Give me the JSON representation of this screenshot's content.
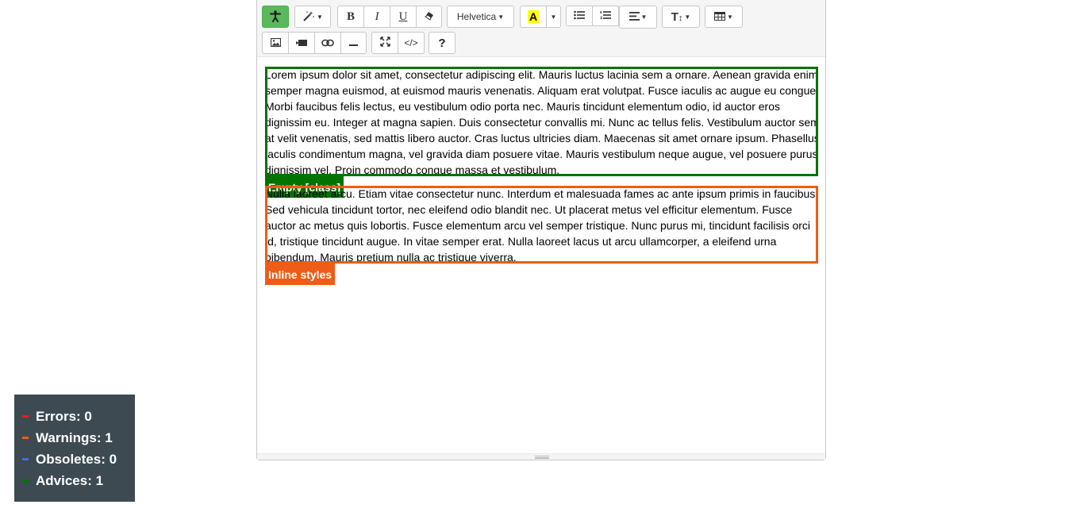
{
  "toolbar": {
    "font_name": "Helvetica",
    "code_view_label": "</>",
    "help_label": "?",
    "bold_label": "B",
    "italic_label": "I",
    "underline_label": "U",
    "text_size_label": "T"
  },
  "content": {
    "paragraph_1": "Lorem ipsum dolor sit amet, consectetur adipiscing elit. Mauris luctus lacinia sem a ornare. Aenean gravida enim semper magna euismod, at euismod mauris venenatis. Aliquam erat volutpat. Fusce iaculis ac augue eu congue. Morbi faucibus felis lectus, eu vestibulum odio porta nec. Mauris tincidunt elementum odio, id auctor eros dignissim eu. Integer at magna sapien. Duis consectetur convallis mi. Nunc ac tellus felis. Vestibulum auctor sem at velit venenatis, sed mattis libero auctor. Cras luctus ultricies diam. Maecenas sit amet ornare ipsum. Phasellus iaculis condimentum magna, vel gravida diam posuere vitae. Mauris vestibulum neque augue, vel posuere purus dignissim vel. Proin commodo congue massa et vestibulum.",
    "paragraph_2": "Nulla laoreet arcu. Etiam vitae consectetur nunc. Interdum et malesuada fames ac ante ipsum primis in faucibus. Sed vehicula tincidunt tortor, nec eleifend odio blandit nec. Ut placerat metus vel efficitur elementum. Fusce auctor ac metus quis lobortis. Fusce elementum arcu vel semper tristique. Nunc purus mi, tincidunt facilisis orci id, tristique tincidunt augue. In vitae semper erat. Nulla laoreet lacus ut arcu ullamcorper, a eleifend urna bibendum. Mauris pretium nulla ac tristique viverra.",
    "tag_1": "Empty [class]",
    "tag_2": "Inline styles"
  },
  "stats": {
    "errors": "Errors: 0",
    "warnings": "Warnings: 1",
    "obsoletes": "Obsoletes: 0",
    "advices": "Advices: 1"
  },
  "colors": {
    "advice_green": "#007300",
    "warning_orange": "#ee5c17",
    "error_red": "#d9212a",
    "obsolete_blue": "#3b6fe0",
    "panel_bg": "#3e4a51",
    "accessibility_green": "#5cb85c"
  },
  "icons": {
    "accessibility": "accessibility-icon",
    "magic": "magic-wand-icon",
    "eraser": "eraser-icon",
    "text_color": "text-color-icon",
    "unordered_list": "unordered-list-icon",
    "ordered_list": "ordered-list-icon",
    "align": "align-icon",
    "table": "table-icon",
    "picture": "picture-icon",
    "video": "video-icon",
    "link": "link-icon",
    "hr": "horizontal-rule-icon",
    "fullscreen": "fullscreen-icon",
    "code": "code-view-icon",
    "help": "help-icon"
  }
}
